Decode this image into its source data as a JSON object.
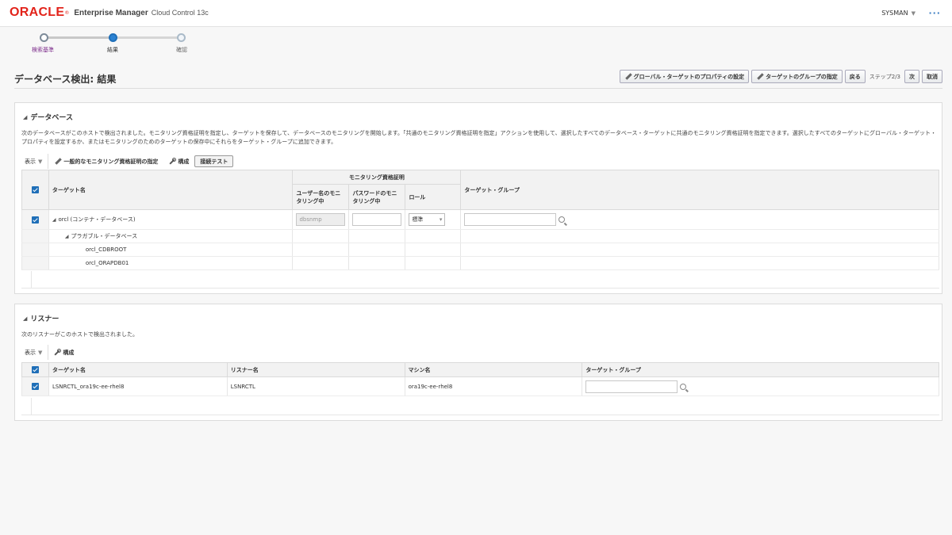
{
  "header": {
    "brand": "ORACLE",
    "product": "Enterprise Manager",
    "product_sub": "Cloud Control 13c",
    "user": "SYSMAN",
    "more": "···"
  },
  "train": {
    "steps": [
      {
        "label": "検索基準",
        "state": "visited"
      },
      {
        "label": "結果",
        "state": "current"
      },
      {
        "label": "確認",
        "state": "unvisited"
      }
    ]
  },
  "page": {
    "title": "データベース検出: 結果",
    "btn_global_props": "グローバル・ターゲットのプロパティの設定",
    "btn_target_group": "ターゲットのグループの指定",
    "btn_back": "戻る",
    "step_text": "ステップ2/3",
    "btn_next": "次",
    "btn_cancel": "取消"
  },
  "databases": {
    "title": "データベース",
    "description": "次のデータベースがこのホストで検出されました。モニタリング資格証明を指定し、ターゲットを保存して、データベースのモニタリングを開始します。「共通のモニタリング資格証明を指定」アクションを使用して、選択したすべてのデータベース・ターゲットに共通のモニタリング資格証明を指定できます。選択したすべてのターゲットにグローバル・ターゲット・プロパティを設定するか、またはモニタリングのためのターゲットの保存中にそれらをターゲット・グループに追加できます。",
    "toolbar": {
      "view": "表示",
      "common_cred": "一般的なモニタリング資格証明の指定",
      "configure": "構成",
      "test_conn": "接続テスト"
    },
    "columns": {
      "target_name": "ターゲット名",
      "monitoring_cred": "モニタリング資格証明",
      "username": "ユーザー名のモニタリング中",
      "password": "パスワードのモニタリング中",
      "role": "ロール",
      "target_group": "ターゲット・グループ"
    },
    "rows": {
      "cdb": {
        "name": "orcl (コンテナ・データベース)",
        "username": "dbsnmp",
        "role": "標準"
      },
      "pdb_group": "プラガブル・データベース",
      "pdb1": "orcl_CDBROOT",
      "pdb2": "orcl_ORAPDB01"
    }
  },
  "listeners": {
    "title": "リスナー",
    "description": "次のリスナーがこのホストで検出されました。",
    "toolbar": {
      "view": "表示",
      "configure": "構成"
    },
    "columns": {
      "target_name": "ターゲット名",
      "listener_name": "リスナー名",
      "machine_name": "マシン名",
      "target_group": "ターゲット・グループ"
    },
    "rows": [
      {
        "target_name": "LSNRCTL_ora19c-ee-rhel8",
        "listener_name": "LSNRCTL",
        "machine_name": "ora19c-ee-rhel8"
      }
    ]
  },
  "colors": {
    "brand_red": "#e2231a",
    "accent_blue": "#1f6fb8",
    "visited_purple": "#7b2a8a"
  }
}
